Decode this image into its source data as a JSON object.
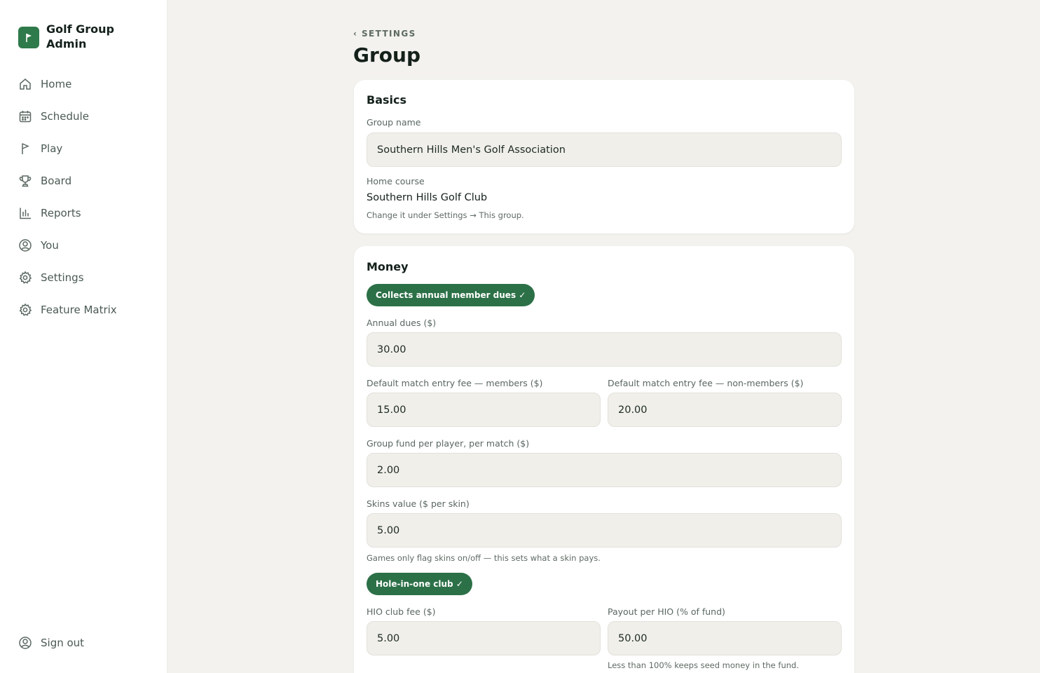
{
  "app": {
    "title": "Golf Group Admin"
  },
  "sidebar": {
    "items": [
      {
        "label": "Home",
        "icon": "home-icon"
      },
      {
        "label": "Schedule",
        "icon": "calendar-icon"
      },
      {
        "label": "Play",
        "icon": "flag-icon"
      },
      {
        "label": "Board",
        "icon": "trophy-icon"
      },
      {
        "label": "Reports",
        "icon": "bar-chart-icon"
      },
      {
        "label": "You",
        "icon": "user-circle-icon"
      },
      {
        "label": "Settings",
        "icon": "gear-icon"
      },
      {
        "label": "Feature Matrix",
        "icon": "gear-icon"
      }
    ],
    "signout": {
      "label": "Sign out",
      "icon": "user-circle-icon"
    }
  },
  "header": {
    "back_label": "SETTINGS",
    "back_icon": "chevron-left-icon",
    "title": "Group"
  },
  "basics": {
    "title": "Basics",
    "group_name_label": "Group name",
    "group_name_value": "Southern Hills Men's Golf Association",
    "home_course_label": "Home course",
    "home_course_value": "Southern Hills Golf Club",
    "home_course_hint": "Change it under Settings → This group."
  },
  "money": {
    "title": "Money",
    "dues_toggle": "Collects annual member dues ✓",
    "annual_dues_label": "Annual dues ($)",
    "annual_dues_value": "30.00",
    "entry_members_label": "Default match entry fee — members ($)",
    "entry_members_value": "15.00",
    "entry_nonmembers_label": "Default match entry fee — non-members ($)",
    "entry_nonmembers_value": "20.00",
    "group_fund_label": "Group fund per player, per match ($)",
    "group_fund_value": "2.00",
    "skins_label": "Skins value ($ per skin)",
    "skins_value": "5.00",
    "skins_hint": "Games only flag skins on/off — this sets what a skin pays.",
    "hio_toggle": "Hole-in-one club ✓",
    "hio_fee_label": "HIO club fee ($)",
    "hio_fee_value": "5.00",
    "hio_payout_label": "Payout per HIO (% of fund)",
    "hio_payout_value": "50.00",
    "hio_payout_hint": "Less than 100% keeps seed money in the fund."
  },
  "colors": {
    "accent": "#2c7047",
    "background": "#f3f2ee",
    "card": "#ffffff",
    "input": "#f0efea"
  }
}
